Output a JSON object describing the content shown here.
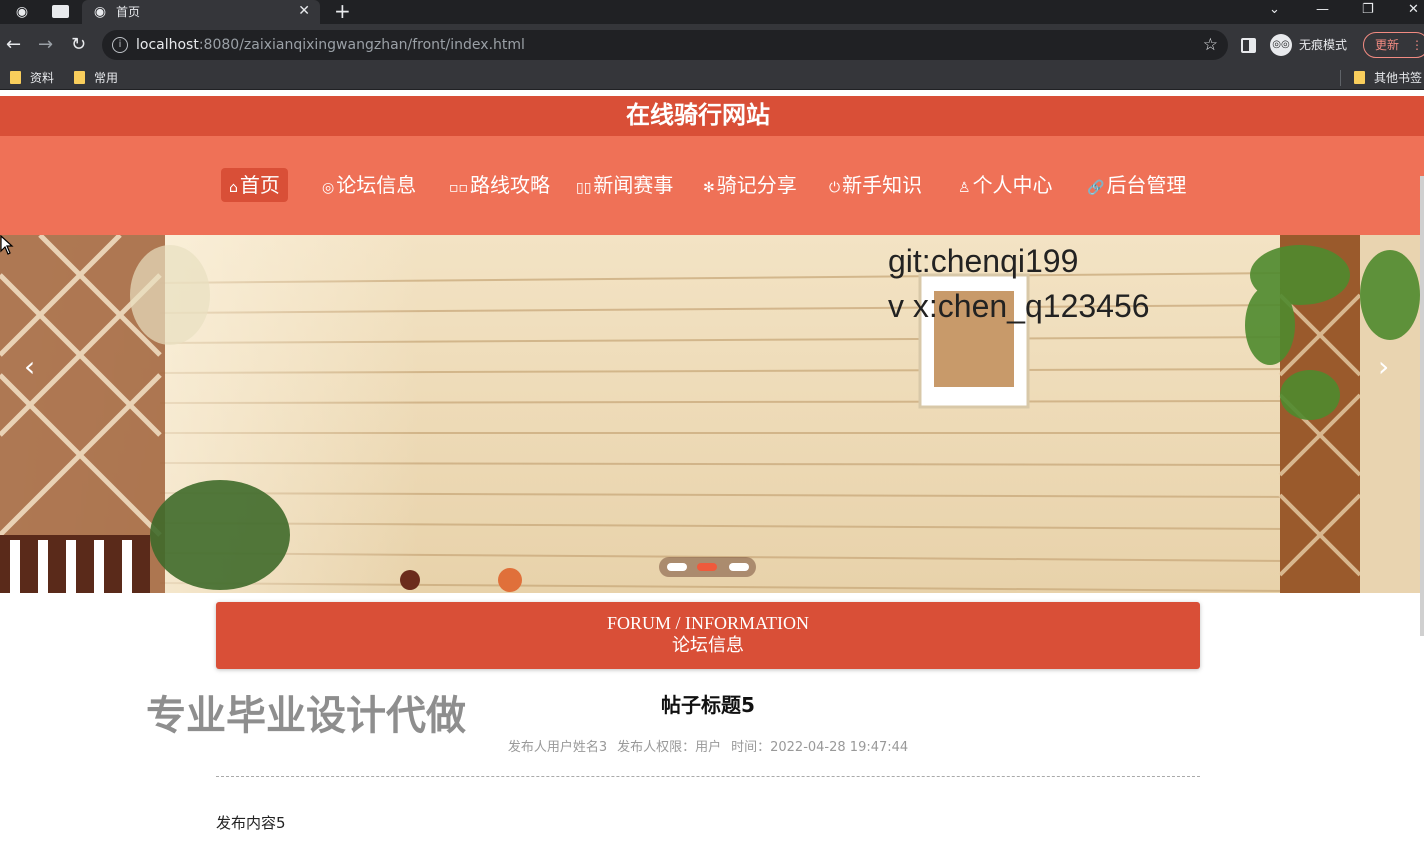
{
  "browser": {
    "tab_title": "首页",
    "new_tab": "+",
    "url_host": "localhost",
    "url_rest": ":8080/zaixianqixingwangzhan/front/index.html",
    "incognito_label": "无痕模式",
    "update_label": "更新",
    "bookmarks": [
      "资料",
      "常用"
    ],
    "other_bookmarks": "其他书签"
  },
  "site": {
    "title": "在线骑行网站",
    "nav": [
      {
        "icon": "⌂",
        "label": "首页"
      },
      {
        "icon": "◎",
        "label": "论坛信息"
      },
      {
        "icon": "▫▫",
        "label": "路线攻略"
      },
      {
        "icon": "▯▯",
        "label": "新闻赛事"
      },
      {
        "icon": "✻",
        "label": "骑记分享"
      },
      {
        "icon": "⏻",
        "label": "新手知识"
      },
      {
        "icon": "♙",
        "label": "个人中心"
      },
      {
        "icon": "🔗",
        "label": "后台管理"
      }
    ]
  },
  "banner": {
    "watermark_line1": "git:chenqi199",
    "watermark_line2": "v x:chen_q123456",
    "slide_count": 3,
    "active_slide": 2
  },
  "section": {
    "title_en": "FORUM / INFORMATION",
    "title_cn": "论坛信息"
  },
  "promo_text": "专业毕业设计代做",
  "post": {
    "title": "帖子标题5",
    "author": "发布人用户姓名3",
    "permission": "发布人权限：用户",
    "time": "时间：2022-04-28 19:47:44",
    "content": "发布内容5"
  },
  "colors": {
    "header": "#d94f37",
    "navbar": "#ef7157",
    "section": "#d94f37"
  }
}
